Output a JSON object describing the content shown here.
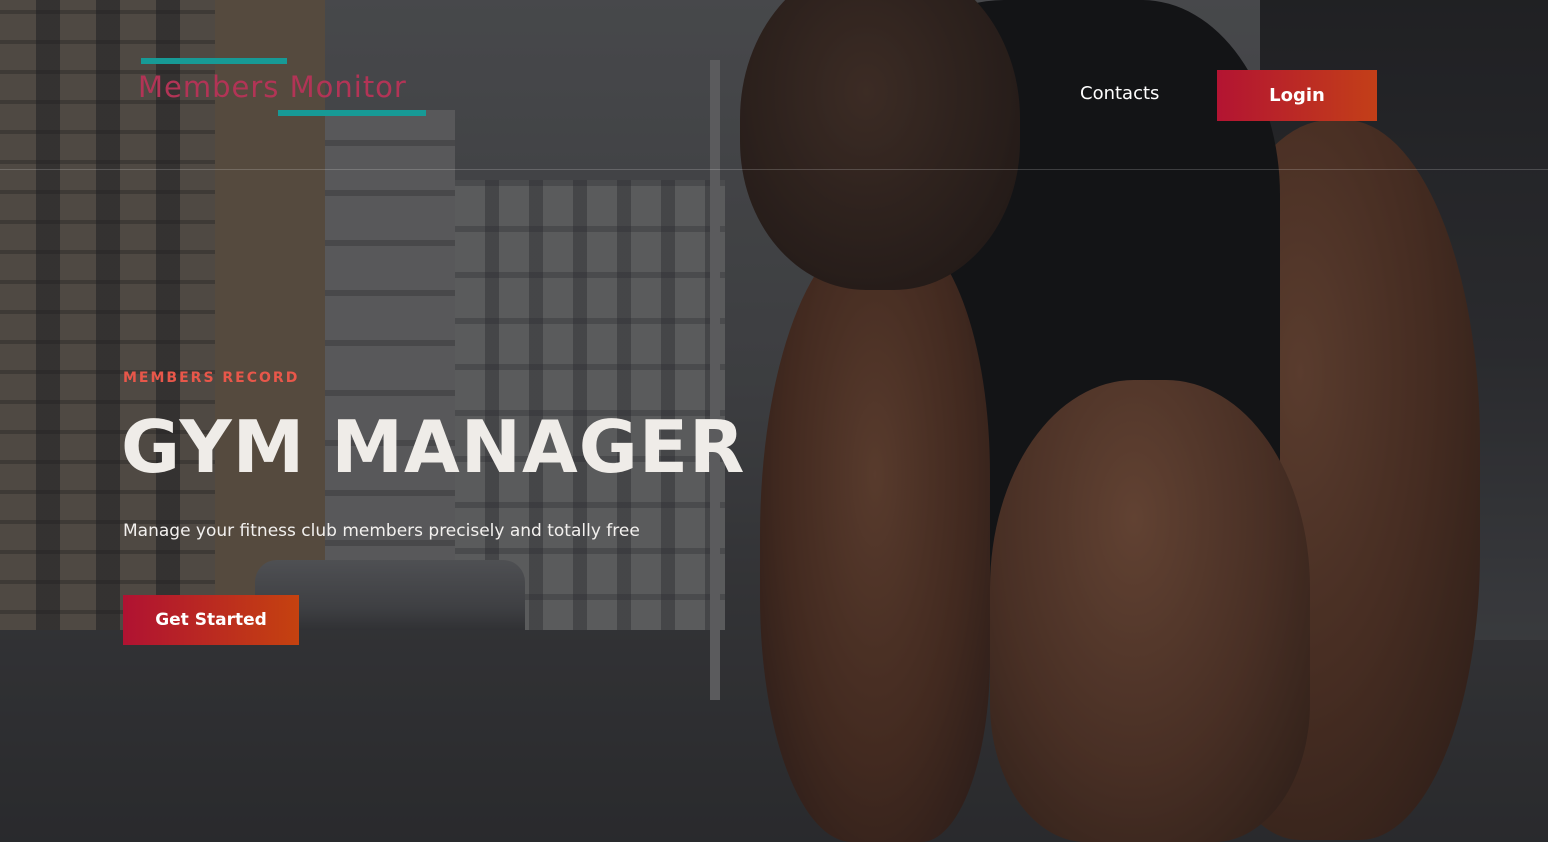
{
  "header": {
    "logo_text": "Members Monitor",
    "nav": {
      "contacts_label": "Contacts"
    },
    "login_label": "Login"
  },
  "hero": {
    "eyebrow": "MEMBERS RECORD",
    "title": "GYM MANAGER",
    "subtitle": "Manage your fitness club members precisely and totally free",
    "cta_label": "Get Started"
  },
  "colors": {
    "brand_text": "#b23456",
    "brand_accent": "#179a96",
    "eyebrow": "#e8574a",
    "button_gradient_start": "#b31432",
    "button_gradient_end": "#c33f18"
  }
}
